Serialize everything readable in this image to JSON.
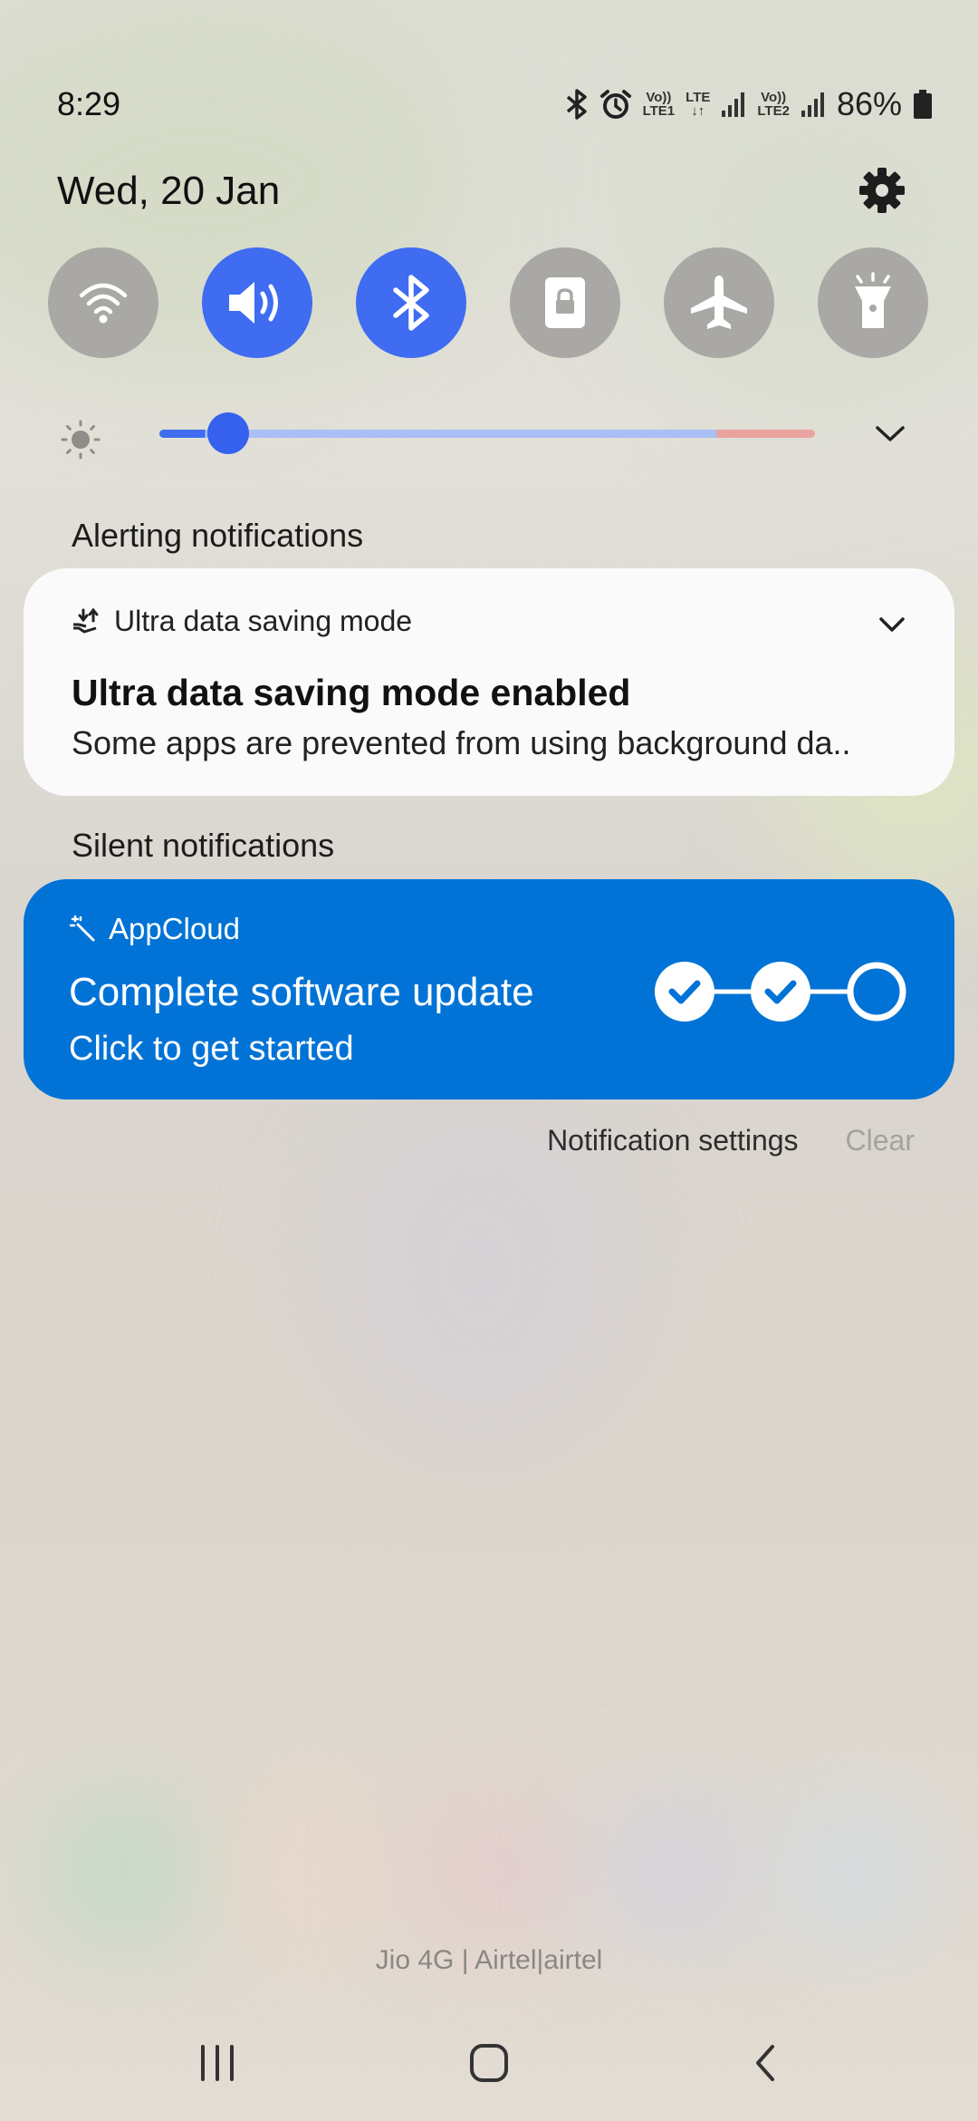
{
  "status_bar": {
    "time": "8:29",
    "battery": "86%",
    "sim1_label_top": "Vo))",
    "sim1_label_bottom": "LTE1",
    "lte_label": "LTE",
    "sim2_label_top": "Vo))",
    "sim2_label_bottom": "LTE2",
    "icons": [
      "bluetooth-icon",
      "alarm-icon",
      "signal-icon",
      "signal-icon",
      "battery-icon"
    ]
  },
  "header": {
    "date": "Wed, 20 Jan"
  },
  "quick_toggles": [
    {
      "name": "wifi",
      "icon": "wifi-icon",
      "active": false
    },
    {
      "name": "sound",
      "icon": "sound-icon",
      "active": true
    },
    {
      "name": "bluetooth",
      "icon": "bluetooth-icon",
      "active": true
    },
    {
      "name": "rotation-lock",
      "icon": "lock-rotation-icon",
      "active": false
    },
    {
      "name": "airplane-mode",
      "icon": "airplane-icon",
      "active": false
    },
    {
      "name": "flashlight",
      "icon": "flashlight-icon",
      "active": false
    }
  ],
  "brightness": {
    "level": 0.07
  },
  "sections": {
    "alerting": "Alerting notifications",
    "silent": "Silent notifications"
  },
  "notifications": {
    "ultra": {
      "app": "Ultra data saving mode",
      "title": "Ultra data saving mode enabled",
      "body": "Some apps are prevented from using background da.."
    },
    "appcloud": {
      "app": "AppCloud",
      "title": "Complete software update",
      "body": "Click to get started",
      "steps_completed": 2,
      "steps_total": 3
    }
  },
  "actions": {
    "settings": "Notification settings",
    "clear": "Clear"
  },
  "carrier": "Jio 4G | Airtel|airtel",
  "colors": {
    "accent": "#3f6cf0",
    "appcloud_card": "#0173d6",
    "toggle_off": "#a9a8a4"
  }
}
